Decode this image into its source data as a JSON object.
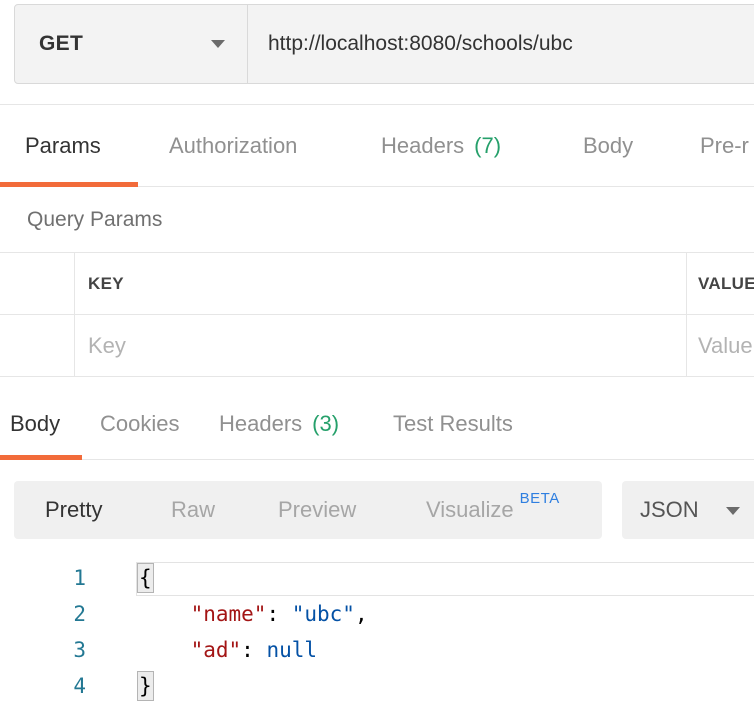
{
  "request": {
    "method": "GET",
    "url": "http://localhost:8080/schools/ubc"
  },
  "request_tabs": [
    {
      "label": "Params",
      "count": "",
      "active": true
    },
    {
      "label": "Authorization",
      "count": ""
    },
    {
      "label": "Headers",
      "count": "(7)"
    },
    {
      "label": "Body",
      "count": ""
    },
    {
      "label": "Pre-r",
      "count": ""
    }
  ],
  "query_params": {
    "title": "Query Params",
    "columns": [
      "KEY",
      "VALUE"
    ],
    "key_placeholder": "Key",
    "value_placeholder": "Value"
  },
  "response_tabs": [
    {
      "label": "Body",
      "count": "",
      "active": true
    },
    {
      "label": "Cookies",
      "count": ""
    },
    {
      "label": "Headers",
      "count": "(3)"
    },
    {
      "label": "Test Results",
      "count": ""
    }
  ],
  "view_options": [
    {
      "label": "Pretty",
      "active": true
    },
    {
      "label": "Raw"
    },
    {
      "label": "Preview"
    },
    {
      "label": "Visualize",
      "badge": "BETA"
    }
  ],
  "format": "JSON",
  "code": {
    "line_numbers": [
      "1",
      "2",
      "3",
      "4"
    ],
    "open_brace": "{",
    "close_brace": "}",
    "name_key": "\"name\"",
    "name_value": "\"ubc\"",
    "ad_key": "\"ad\"",
    "ad_value": "null",
    "colon": ": ",
    "comma": ",",
    "indent": "    "
  },
  "colors": {
    "accent_underline": "#f26b3a",
    "count_green": "#26a06b",
    "beta_blue": "#2f7fe0",
    "json_key": "#a31515",
    "json_value": "#0451a5",
    "line_number": "#237893"
  }
}
